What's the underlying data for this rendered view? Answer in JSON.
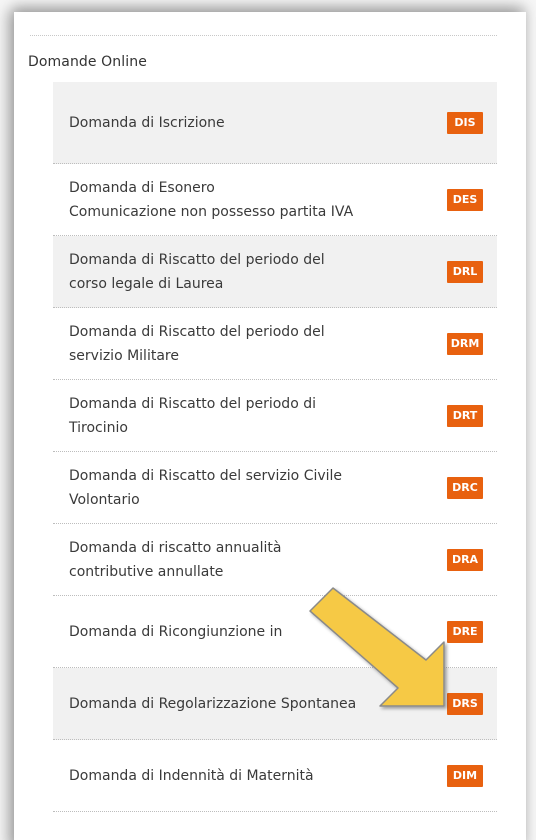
{
  "section_title": "Domande Online",
  "items": [
    {
      "label": "Domanda di Iscrizione",
      "badge": "DIS"
    },
    {
      "label": "Domanda di Esonero\nComunicazione non possesso partita IVA",
      "badge": "DES"
    },
    {
      "label": "Domanda di Riscatto del periodo del\ncorso legale di Laurea",
      "badge": "DRL"
    },
    {
      "label": "Domanda di Riscatto del periodo del\nservizio Militare",
      "badge": "DRM"
    },
    {
      "label": "Domanda di Riscatto del periodo di\nTirocinio",
      "badge": "DRT"
    },
    {
      "label": "Domanda di Riscatto del servizio Civile\nVolontario",
      "badge": "DRC"
    },
    {
      "label": "Domanda di riscatto annualità\ncontributive annullate",
      "badge": "DRA"
    },
    {
      "label": "Domanda di Ricongiunzione in",
      "badge": "DRE"
    },
    {
      "label": "Domanda di Regolarizzazione Spontanea",
      "badge": "DRS"
    },
    {
      "label": "Domanda di Indennità di Maternità",
      "badge": "DIM"
    }
  ],
  "colors": {
    "badge": "#e8610f",
    "arrow_fill": "#f6c945",
    "arrow_stroke": "#8a8a8a"
  },
  "annotation": {
    "icon": "callout-arrow-icon"
  }
}
